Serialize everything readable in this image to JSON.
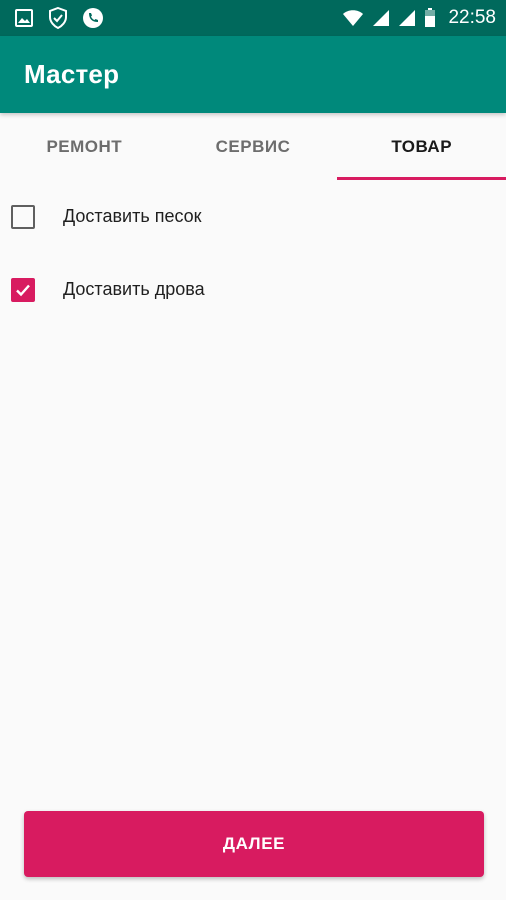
{
  "status_bar": {
    "time": "22:58",
    "left_icons": [
      "image-icon",
      "shield-check-icon",
      "phone-icon"
    ],
    "right_icons": [
      "wifi-icon",
      "signal-icon",
      "signal-icon",
      "battery-icon"
    ]
  },
  "app_bar": {
    "title": "Мастер"
  },
  "tabs": [
    {
      "label": "РЕМОНТ",
      "active": false
    },
    {
      "label": "СЕРВИС",
      "active": false
    },
    {
      "label": "ТОВАР",
      "active": true
    }
  ],
  "items": [
    {
      "label": "Доставить песок",
      "checked": false
    },
    {
      "label": "Доставить дрова",
      "checked": true
    }
  ],
  "next_button": {
    "label": "ДАЛЕЕ"
  },
  "colors": {
    "status_bar": "#00695c",
    "app_bar": "#00897b",
    "accent": "#d81b60"
  }
}
